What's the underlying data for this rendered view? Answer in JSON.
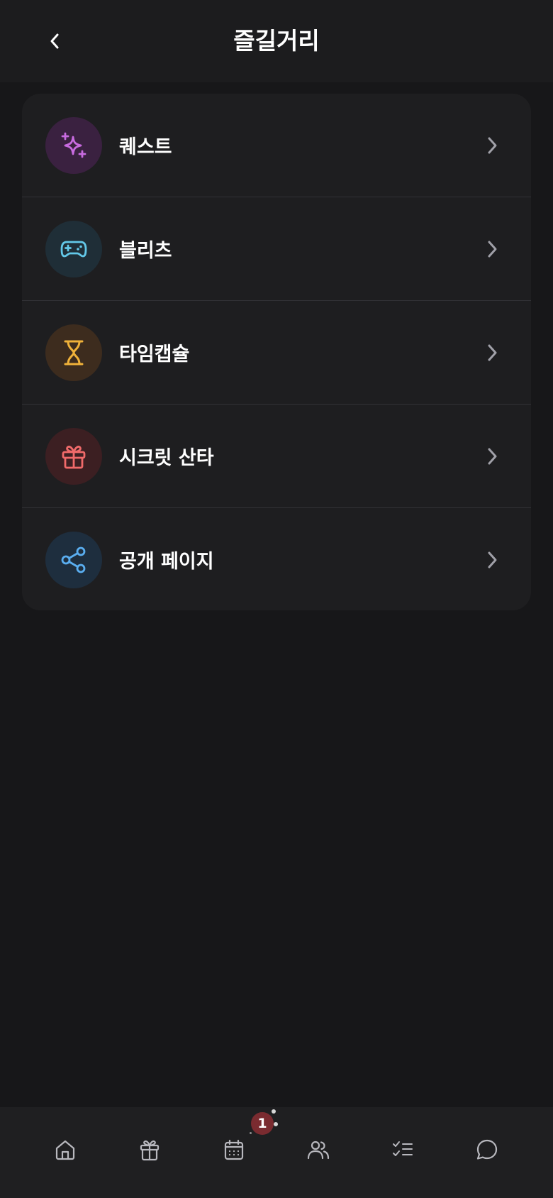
{
  "header": {
    "title": "즐길거리",
    "back_icon": "chevron-left-icon"
  },
  "menu": {
    "items": [
      {
        "label": "퀘스트",
        "icon": "sparkles-icon",
        "icon_color": "#c86be0",
        "icon_bg": "#3a2140"
      },
      {
        "label": "블리츠",
        "icon": "gamepad-icon",
        "icon_color": "#63c8e8",
        "icon_bg": "#1f2e37"
      },
      {
        "label": "타임캡슐",
        "icon": "hourglass-icon",
        "icon_color": "#f0b23a",
        "icon_bg": "#3d2c1e"
      },
      {
        "label": "시크릿 산타",
        "icon": "gift-icon",
        "icon_color": "#f06a6a",
        "icon_bg": "#3c1f22"
      },
      {
        "label": "공개 페이지",
        "icon": "share-icon",
        "icon_color": "#5aaef0",
        "icon_bg": "#1e2e3e"
      }
    ]
  },
  "bottom_nav": {
    "items": [
      {
        "icon": "home-icon"
      },
      {
        "icon": "gift-icon"
      },
      {
        "icon": "calendar-icon",
        "badge": "1"
      },
      {
        "icon": "friends-icon"
      },
      {
        "icon": "checklist-icon"
      },
      {
        "icon": "chat-icon"
      }
    ]
  },
  "colors": {
    "background": "#171719",
    "card": "#1e1e20",
    "header": "#1c1c1e",
    "text": "#ffffff",
    "chevron": "#a0a0a8",
    "nav_icon": "#b8b8be",
    "badge": "#7a2b30"
  }
}
